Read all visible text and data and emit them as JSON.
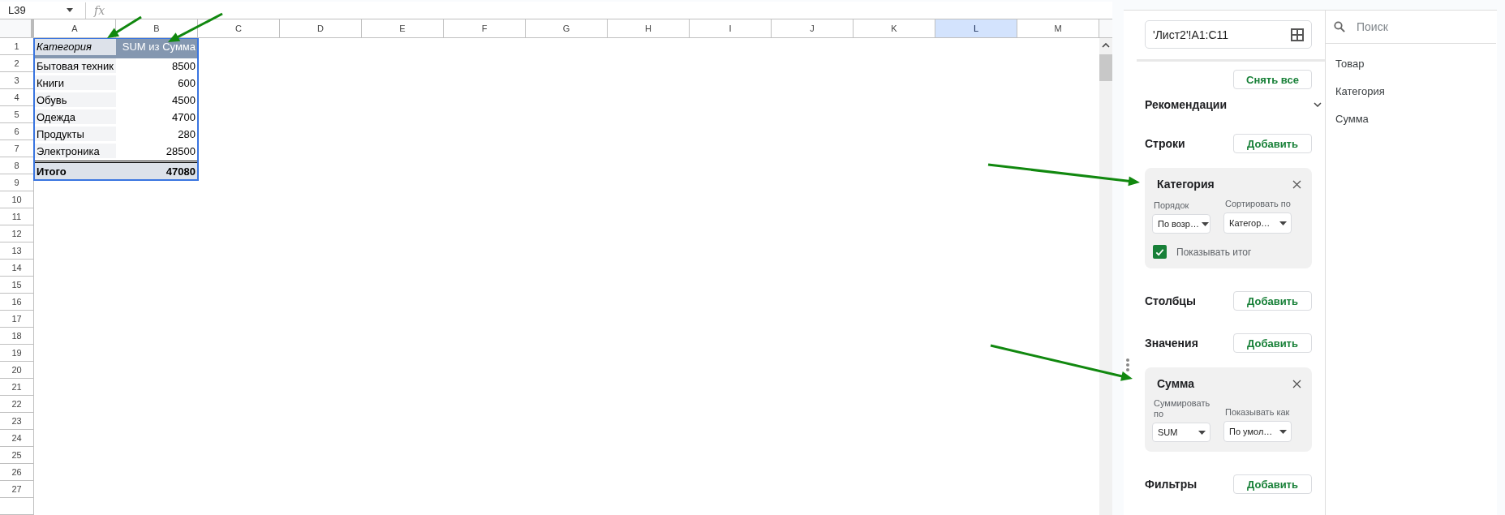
{
  "name_box": {
    "value": "L39"
  },
  "formula_bar": {
    "function_label": "fx"
  },
  "columns": [
    {
      "label": "A",
      "selected": false
    },
    {
      "label": "B",
      "selected": false
    },
    {
      "label": "C",
      "selected": false
    },
    {
      "label": "D",
      "selected": false
    },
    {
      "label": "E",
      "selected": false
    },
    {
      "label": "F",
      "selected": false
    },
    {
      "label": "G",
      "selected": false
    },
    {
      "label": "H",
      "selected": false
    },
    {
      "label": "I",
      "selected": false
    },
    {
      "label": "J",
      "selected": false
    },
    {
      "label": "K",
      "selected": false
    },
    {
      "label": "L",
      "selected": true
    },
    {
      "label": "M",
      "selected": false
    }
  ],
  "row_numbers": [
    "1",
    "2",
    "3",
    "4",
    "5",
    "6",
    "7",
    "8",
    "9",
    "10",
    "11",
    "12",
    "13",
    "14",
    "15",
    "16",
    "17",
    "18",
    "19",
    "20",
    "21",
    "22",
    "23",
    "24",
    "25",
    "26",
    "27"
  ],
  "pivot_table": {
    "header": {
      "label": "Категория",
      "value": "SUM из Сумма"
    },
    "rows": [
      {
        "label": "Бытовая техник",
        "value": "8500"
      },
      {
        "label": "Книги",
        "value": "600"
      },
      {
        "label": "Обувь",
        "value": "4500"
      },
      {
        "label": "Одежда",
        "value": "4700"
      },
      {
        "label": "Продукты",
        "value": "280"
      },
      {
        "label": "Электроника",
        "value": "28500"
      }
    ],
    "total": {
      "label": "Итого",
      "value": "47080"
    }
  },
  "pivot_editor": {
    "range": "'Лист2'!A1:C11",
    "clear_button": "Снять все",
    "suggestions": {
      "label": "Рекомендации",
      "expanded": false
    },
    "sections": [
      {
        "label": "Строки",
        "add_button": "Добавить",
        "cards": [
          {
            "title": "Категория",
            "fields": [
              {
                "label": "Порядок",
                "value": "По возр…"
              },
              {
                "label": "Сортировать по",
                "value": "Категор…"
              }
            ],
            "checkbox": {
              "label": "Показывать итог",
              "checked": true
            }
          }
        ]
      },
      {
        "label": "Столбцы",
        "add_button": "Добавить"
      },
      {
        "label": "Значения",
        "add_button": "Добавить",
        "cards": [
          {
            "title": "Сумма",
            "fields": [
              {
                "label": "Суммировать по",
                "value": "SUM"
              },
              {
                "label": "Показывать как",
                "value": "По умол…"
              }
            ]
          }
        ]
      },
      {
        "label": "Фильтры",
        "add_button": "Добавить"
      }
    ]
  },
  "field_list": {
    "search_placeholder": "Поиск",
    "fields": [
      "Товар",
      "Категория",
      "Сумма"
    ]
  }
}
